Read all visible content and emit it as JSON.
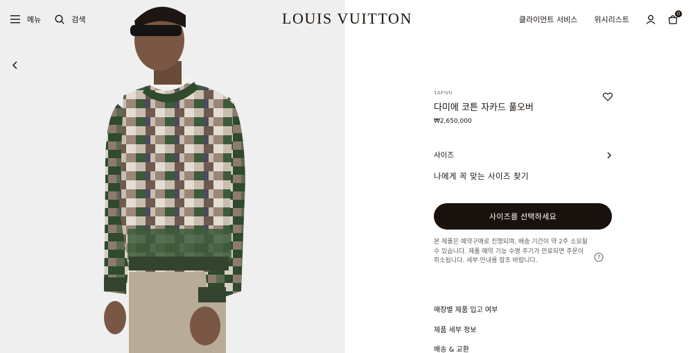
{
  "header": {
    "menu_label": "메뉴",
    "search_label": "검색",
    "logo": "LOUIS VUITTON",
    "client_service": "클라이언트 서비스",
    "wishlist": "위시리스트",
    "bag_count": "0"
  },
  "product": {
    "sku": "1AFIVU",
    "name": "다미에 코튼 자카드 풀오버",
    "price": "₩2,650,000"
  },
  "size": {
    "label": "사이즈",
    "guide": "나에게 꼭 맞는 사이즈 찾기"
  },
  "cta_label": "사이즈를 선택하세요",
  "notice": "본 제품은 예약구매로 진행되며, 배송 기간이 약 2주 소요될 수 있습니다. 제품 예약 기능 수명 주기가 만료되면 주문이 취소됩니다. 세부 안내를 참조 바랍니다.",
  "links": {
    "store_availability": "매장별 제품 입고 여부",
    "product_details": "제품 세부 정보",
    "shipping_returns": "배송 & 교환"
  },
  "colors": {
    "brand_dark": "#19110b",
    "background_image": "#efefef"
  }
}
